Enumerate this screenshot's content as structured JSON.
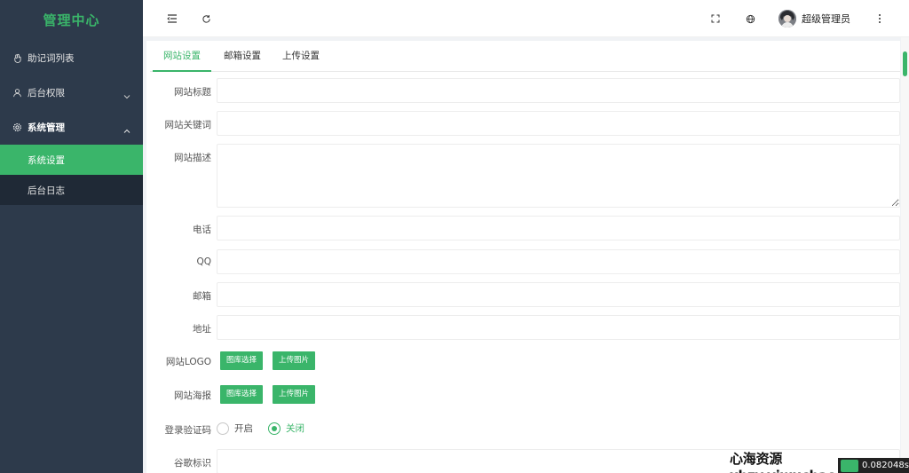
{
  "sidebar": {
    "logo": "管理中心",
    "items": [
      {
        "label": "助记词列表",
        "icon": "hand-icon"
      },
      {
        "label": "后台权限",
        "icon": "user-icon"
      },
      {
        "label": "系统管理",
        "icon": "gear-icon"
      }
    ],
    "subitems": [
      {
        "label": "系统设置"
      },
      {
        "label": "后台日志"
      }
    ]
  },
  "header": {
    "user_name": "超级管理员",
    "icons": [
      "menu-fold-icon",
      "refresh-icon",
      "fullscreen-icon",
      "globe-icon",
      "more-icon"
    ]
  },
  "tabs": [
    {
      "label": "网站设置"
    },
    {
      "label": "邮箱设置"
    },
    {
      "label": "上传设置"
    }
  ],
  "form": {
    "title_label": "网站标题",
    "keywords_label": "网站关键词",
    "description_label": "网站描述",
    "phone_label": "电话",
    "qq_label": "QQ",
    "email_label": "邮箱",
    "address_label": "地址",
    "logo_label": "网站LOGO",
    "poster_label": "网站海报",
    "captcha_label": "登录验证码",
    "google_label": "谷歌标识",
    "btn_gallery": "图库选择",
    "btn_upload": "上传图片",
    "radio_on": "开启",
    "radio_off": "关闭",
    "captcha_value": "关闭"
  },
  "watermark": {
    "text": "心海资源xhzy.yiwuchao.cn",
    "timer": "0.082048s"
  },
  "colors": {
    "accent": "#3ab56a",
    "sidebar_bg": "#2d3a4b",
    "submenu_bg": "#1f2936"
  }
}
